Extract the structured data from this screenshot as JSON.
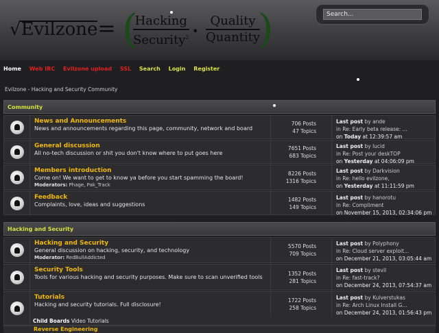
{
  "header": {
    "logo": {
      "name": "Evilzone",
      "frac1_top": "Hacking",
      "frac1_bottom": "Security",
      "frac1_exp": "2",
      "frac2_top": "Quality",
      "frac2_bottom": "Quantity"
    },
    "search_placeholder": "Search..."
  },
  "nav": {
    "items": [
      {
        "label": "Home",
        "color": "#ffffff"
      },
      {
        "label": "Web IRC",
        "color": "#e02020"
      },
      {
        "label": "Evilzone upload",
        "color": "#e02020"
      },
      {
        "label": "SSL",
        "color": "#e02020"
      },
      {
        "label": "Search",
        "color": "#d7e23c"
      },
      {
        "label": "Login",
        "color": "#d7e23c"
      },
      {
        "label": "Register",
        "color": "#d7e23c"
      }
    ]
  },
  "breadcrumb": "Evilzone - Hacking and Security Community",
  "categories": [
    {
      "name": "Community",
      "boards": [
        {
          "title": "News and Announcements",
          "desc": "News and announcements regarding this page, community, network and board",
          "mods": "",
          "posts": "706 Posts",
          "topics": "47 Topics",
          "last_by": "ande",
          "last_in": "Re: Early beta release: ...",
          "last_on_prefix": "on",
          "last_date_bold": "Today",
          "last_date": " at 12:39:57 am"
        },
        {
          "title": "General discussion",
          "desc": "All no-tech discussion or shit you don't know where to put goes here",
          "mods": "",
          "posts": "7651 Posts",
          "topics": "683 Topics",
          "last_by": "lucid",
          "last_in": "Re: Post your deskTOP",
          "last_on_prefix": "on",
          "last_date_bold": "Yesterday",
          "last_date": " at 04:06:09 pm"
        },
        {
          "title": "Members introduction",
          "desc": "Come on! We want to get to know ya before you start spamming the board!",
          "mods": "Phage, Pak_Track",
          "posts": "8226 Posts",
          "topics": "1316 Topics",
          "last_by": "Darkvision",
          "last_in": "Re: hello evilzone,",
          "last_on_prefix": "on",
          "last_date_bold": "Yesterday",
          "last_date": " at 11:11:59 pm"
        },
        {
          "title": "Feedback",
          "desc": "Complaints, love, ideas and suggestions",
          "mods": "",
          "posts": "1482 Posts",
          "topics": "149 Topics",
          "last_by": "hanorotu",
          "last_in": "Re: Compliment",
          "last_on_prefix": "on",
          "last_date_bold": "",
          "last_date": "November 15, 2013, 02:34:06 pm"
        }
      ]
    },
    {
      "name": "Hacking and Security",
      "boards": [
        {
          "title": "Hacking and Security",
          "desc": "General discussion on hacking, security, and technology",
          "mods": "RedBullAddicted",
          "posts": "5570 Posts",
          "topics": "709 Topics",
          "last_by": "Polyphony",
          "last_in": "Re: Cloud server exploit...",
          "last_on_prefix": "on",
          "last_date_bold": "",
          "last_date": "December 21, 2013, 03:05:44 am"
        },
        {
          "title": "Security Tools",
          "desc": "Tools for various hacking and security purposes. Make sure to scan unverified tools",
          "mods": "",
          "posts": "1352 Posts",
          "topics": "281 Topics",
          "last_by": "stevil",
          "last_in": "Re: fast-track?",
          "last_on_prefix": "on",
          "last_date_bold": "",
          "last_date": "December 24, 2013, 07:54:37 am"
        },
        {
          "title": "Tutorials",
          "desc": "Hacking and security tutorials. Full disclosure!",
          "mods": "",
          "posts": "1722 Posts",
          "topics": "258 Topics",
          "last_by": "Kulverstukas",
          "last_in": "Re: Arch Linux Install G...",
          "last_on_prefix": "on",
          "last_date_bold": "",
          "last_date": "December 24, 2013, 01:56:43 pm"
        }
      ]
    }
  ],
  "labels": {
    "moderators": "Moderators:",
    "moderator": "Moderator:",
    "last_post": "Last post",
    "by": "by",
    "in": "in"
  },
  "child_boards": {
    "label": "Child Boards",
    "items": "Video Tutorials"
  },
  "cut_board_title": "Reverse Engineering"
}
